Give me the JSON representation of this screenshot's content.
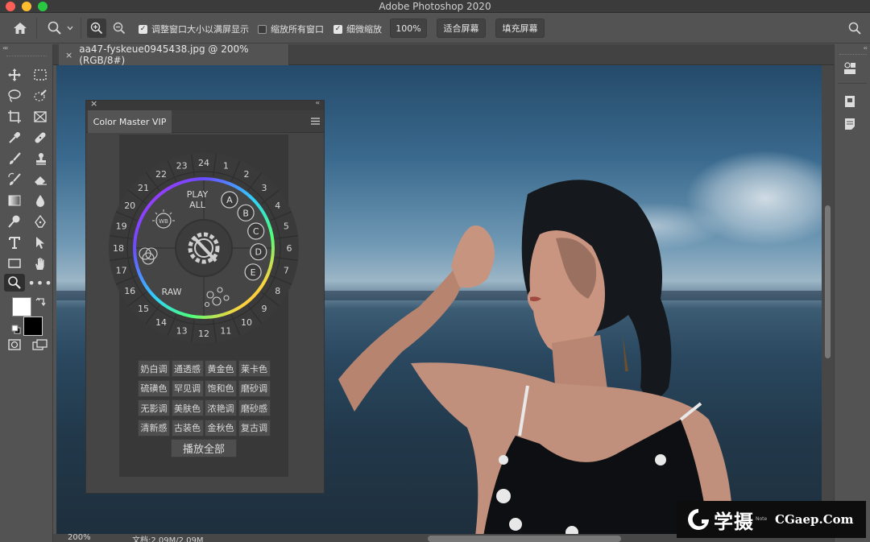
{
  "window": {
    "title": "Adobe Photoshop 2020"
  },
  "options_bar": {
    "resize_windows_label": "调整窗口大小以满屏显示",
    "resize_windows_checked": true,
    "zoom_all_windows_label": "缩放所有窗口",
    "zoom_all_windows_checked": false,
    "scrubby_zoom_label": "细微缩放",
    "scrubby_zoom_checked": true,
    "zoom_100_label": "100%",
    "fit_screen_label": "适合屏幕",
    "fill_screen_label": "填充屏幕"
  },
  "document": {
    "tab_title": "aa47-fyskeue0945438.jpg @ 200%(RGB/8#)",
    "close_glyph": "×"
  },
  "status_bar": {
    "zoom": "200%",
    "doc_info": "文档:2.09M/2.09M"
  },
  "color_master": {
    "tab_title": "Color Master VIP",
    "close_glyph": "×",
    "collapse_glyph": "‹‹",
    "wheel": {
      "play_all": [
        "PLAY",
        "ALL"
      ],
      "raw_label": "RAW",
      "wb_label": "WB",
      "letters": [
        "A",
        "B",
        "C",
        "D",
        "E"
      ],
      "numbers": [
        "1",
        "2",
        "3",
        "4",
        "5",
        "6",
        "7",
        "8",
        "9",
        "10",
        "11",
        "12",
        "13",
        "14",
        "15",
        "16",
        "17",
        "18",
        "19",
        "20",
        "21",
        "22",
        "23",
        "24"
      ]
    },
    "presets": [
      [
        "奶白调",
        "通透感",
        "黄金色",
        "莱卡色"
      ],
      [
        "硫磺色",
        "罕见调",
        "饱和色",
        "磨砂调"
      ],
      [
        "无影调",
        "美肤色",
        "浓艳调",
        "磨砂感"
      ],
      [
        "清新感",
        "古装色",
        "金秋色",
        "复古调"
      ]
    ],
    "play_all_label": "播放全部"
  },
  "panel_collapse_glyph": "‹‹",
  "watermark": {
    "chinese": "学摄",
    "small": "Note",
    "english": "CGaep.Com"
  },
  "colors": {
    "ui_gray": "#535353",
    "dark_gray": "#424242",
    "wheel_ring": "#3a3a3a"
  }
}
